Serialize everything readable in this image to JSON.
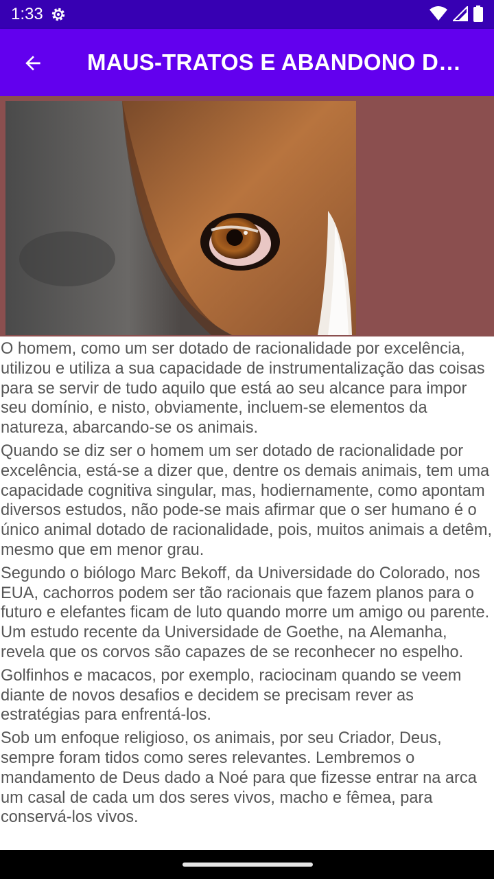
{
  "status_bar": {
    "time": "1:33",
    "icons": [
      "settings-gear-icon",
      "wifi-icon",
      "cellular-signal-icon",
      "battery-icon"
    ]
  },
  "app_bar": {
    "title": "MAUS-TRATOS E ABANDONO DE…",
    "back_icon": "arrow-back-icon"
  },
  "hero_image": {
    "subject": "close-up-beagle-eye-photo"
  },
  "article": {
    "paragraphs": [
      "O homem, como um ser dotado de racionalidade por excelência, utilizou e utiliza a sua capacidade de instrumentalização das coisas para se servir de tudo aquilo que está ao seu alcance para impor seu domínio, e nisto, obviamente, incluem-se elementos da natureza, abarcando-se os animais.",
      "Quando se diz ser o homem um ser dotado de racionalidade por excelência, está-se a dizer que, dentre os demais animais, tem uma capacidade cognitiva singular, mas, hodiernamente, como apontam diversos estudos, não pode-se mais afirmar que o ser humano é o único animal dotado de racionalidade, pois, muitos animais a detêm, mesmo que em menor grau.",
      "Segundo o biólogo Marc Bekoff, da Universidade do Colorado, nos EUA, cachorros podem ser tão racionais que fazem planos para o futuro e elefantes ficam de luto quando morre um amigo ou parente. Um estudo recente da Universidade de Goethe, na Alemanha, revela que os corvos são capazes de se reconhecer no espelho.",
      "Golfinhos e macacos, por exemplo, raciocinam quando se veem diante de novos desafios e decidem se precisam rever as estratégias para enfrentá-los.",
      "Sob um enfoque religioso, os animais, por seu Criador, Deus, sempre foram tidos como seres relevantes. Lembremos o mandamento de Deus dado a Noé para que fizesse entrar na arca um casal de cada um dos seres vivos, macho e fêmea, para conservá-los vivos."
    ]
  },
  "colors": {
    "status_bar": "#3700b3",
    "app_bar": "#6200ee",
    "image_background": "#8b4f4f",
    "body_text": "#555555"
  }
}
